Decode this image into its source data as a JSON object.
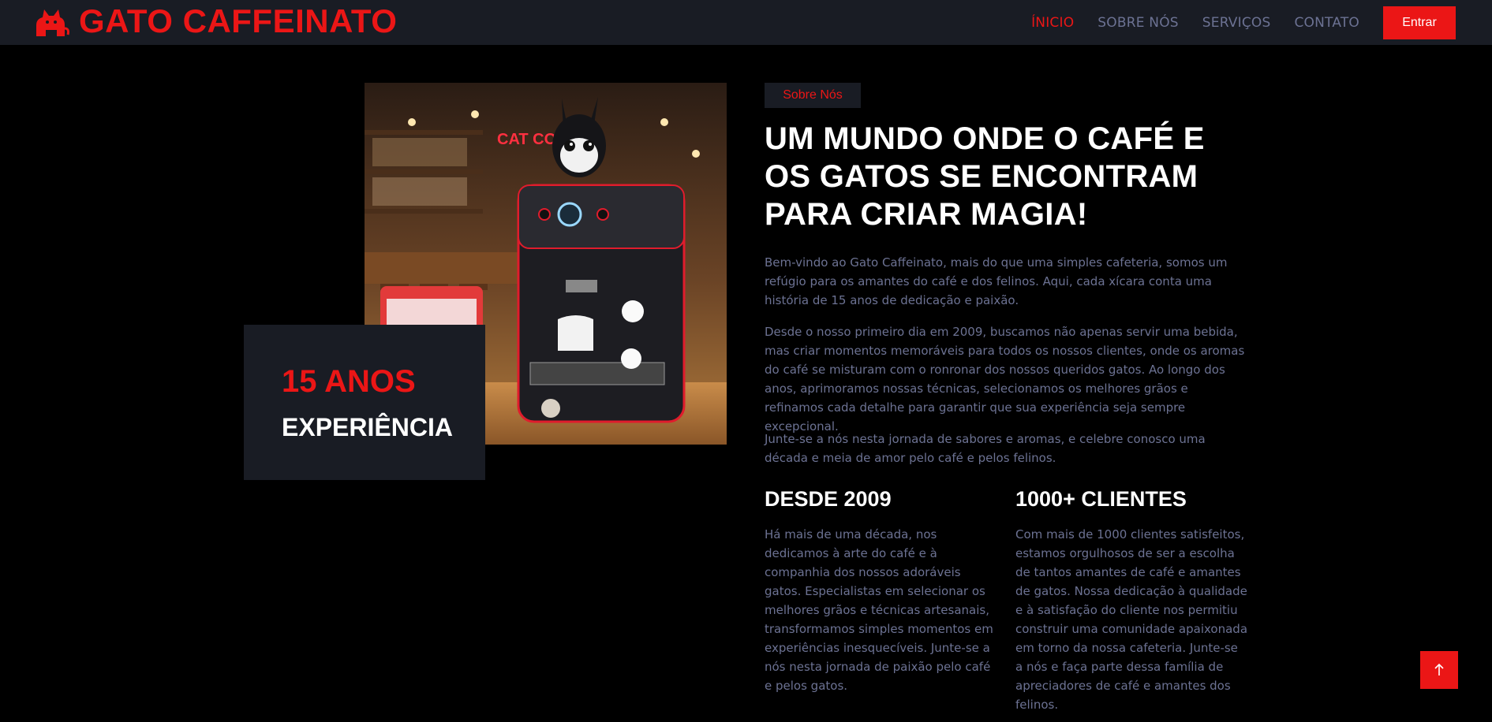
{
  "brand": {
    "name": "GATO CAFFEINATO",
    "icon": "cat-icon"
  },
  "nav": {
    "items": [
      {
        "label": "ÍNICIO",
        "active": true
      },
      {
        "label": "SOBRE NÓS",
        "active": false
      },
      {
        "label": "SERVIÇOS",
        "active": false
      },
      {
        "label": "CONTATO",
        "active": false
      }
    ],
    "login_label": "Entrar"
  },
  "experience": {
    "years": "15 ANOS",
    "label": "EXPERIÊNCIA"
  },
  "about": {
    "tag": "Sobre Nós",
    "headline": "UM MUNDO ONDE O CAFÉ E OS GATOS SE ENCONTRAM PARA CRIAR MAGIA!",
    "paragraphs": [
      "Bem-vindo ao Gato Caffeinato, mais do que uma simples cafeteria, somos um refúgio para os amantes do café e dos felinos. Aqui, cada xícara conta uma história de 15 anos de dedicação e paixão.",
      "Desde o nosso primeiro dia em 2009, buscamos não apenas servir uma bebida, mas criar momentos memoráveis para todos os nossos clientes, onde os aromas do café se misturam com o ronronar dos nossos queridos gatos. Ao longo dos anos, aprimoramos nossas técnicas, selecionamos os melhores grãos e refinamos cada detalhe para garantir que sua experiência seja sempre excepcional.",
      "Junte-se a nós nesta jornada de sabores e aromas, e celebre conosco uma década e meia de amor pelo café e pelos felinos."
    ],
    "features": [
      {
        "title": "DESDE 2009",
        "text": "Há mais de uma década, nos dedicamos à arte do café e à companhia dos nossos adoráveis gatos. Especialistas em selecionar os melhores grãos e técnicas artesanais, transformamos simples momentos em experiências inesquecíveis. Junte-se a nós nesta jornada de paixão pelo café e pelos gatos."
      },
      {
        "title": "1000+ CLIENTES",
        "text": "Com mais de 1000 clientes satisfeitos, estamos orgulhosos de ser a escolha de tantos amantes de café e amantes de gatos. Nossa dedicação à qualidade e à satisfação do cliente nos permitiu construir uma comunidade apaixonada em torno da nossa cafeteria. Junte-se a nós e faça parte dessa família de apreciadores de café e amantes dos felinos."
      }
    ]
  },
  "photo_sign": "CAT COFFEE",
  "back_to_top_icon": "arrow-up-icon",
  "colors": {
    "accent": "#eb1616",
    "panel": "#191c24",
    "muted": "#6c7293",
    "background": "#000000"
  }
}
